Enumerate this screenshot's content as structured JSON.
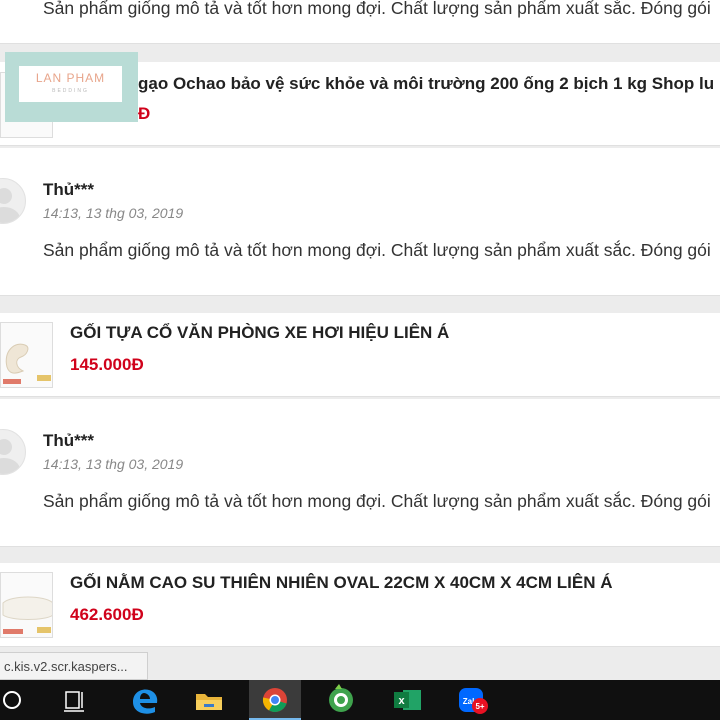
{
  "reviews": [
    {
      "name": "",
      "date": "",
      "text": "Sản phẩm giống mô tả và tốt hơn mong đợi. Chất lượng sản phẩm xuất sắc. Đóng gói"
    },
    {
      "name": "Thủ***",
      "date": "14:13, 13 thg 03, 2019",
      "text": "Sản phẩm giống mô tả và tốt hơn mong đợi. Chất lượng sản phẩm xuất sắc. Đóng gói"
    },
    {
      "name": "Thủ***",
      "date": "14:13, 13 thg 03, 2019",
      "text": "Sản phẩm giống mô tả và tốt hơn mong đợi. Chất lượng sản phẩm xuất sắc. Đóng gói"
    }
  ],
  "products": [
    {
      "title": "gạo Ochao bảo vệ sức khỏe và môi trường 200 ống 2 bịch 1 kg Shop lu",
      "price": "Đ"
    },
    {
      "title": "GỐI TỰA CỔ VĂN PHÒNG XE HƠI HIỆU LIÊN Á",
      "price": "145.000Đ"
    },
    {
      "title": "GỐI NẰM CAO SU THIÊN NHIÊN OVAL 22CM X 40CM X 4CM LIÊN Á",
      "price": "462.600Đ"
    }
  ],
  "logo": {
    "name": "LAN PHAM",
    "sub": "BEDDING"
  },
  "status_url": "c.kis.v2.scr.kaspers...",
  "taskbar": {
    "items": [
      "cortana-icon",
      "task-view-icon",
      "edge-icon",
      "file-explorer-icon",
      "chrome-icon",
      "coccoc-icon",
      "excel-icon",
      "zalo-icon"
    ],
    "zalo_label": "Zalo",
    "zalo_badge": "5+"
  },
  "colors": {
    "price": "#d0021b",
    "logo_bg": "#b9dcd6",
    "logo_text": "#e8a58b",
    "taskbar": "#101010"
  }
}
